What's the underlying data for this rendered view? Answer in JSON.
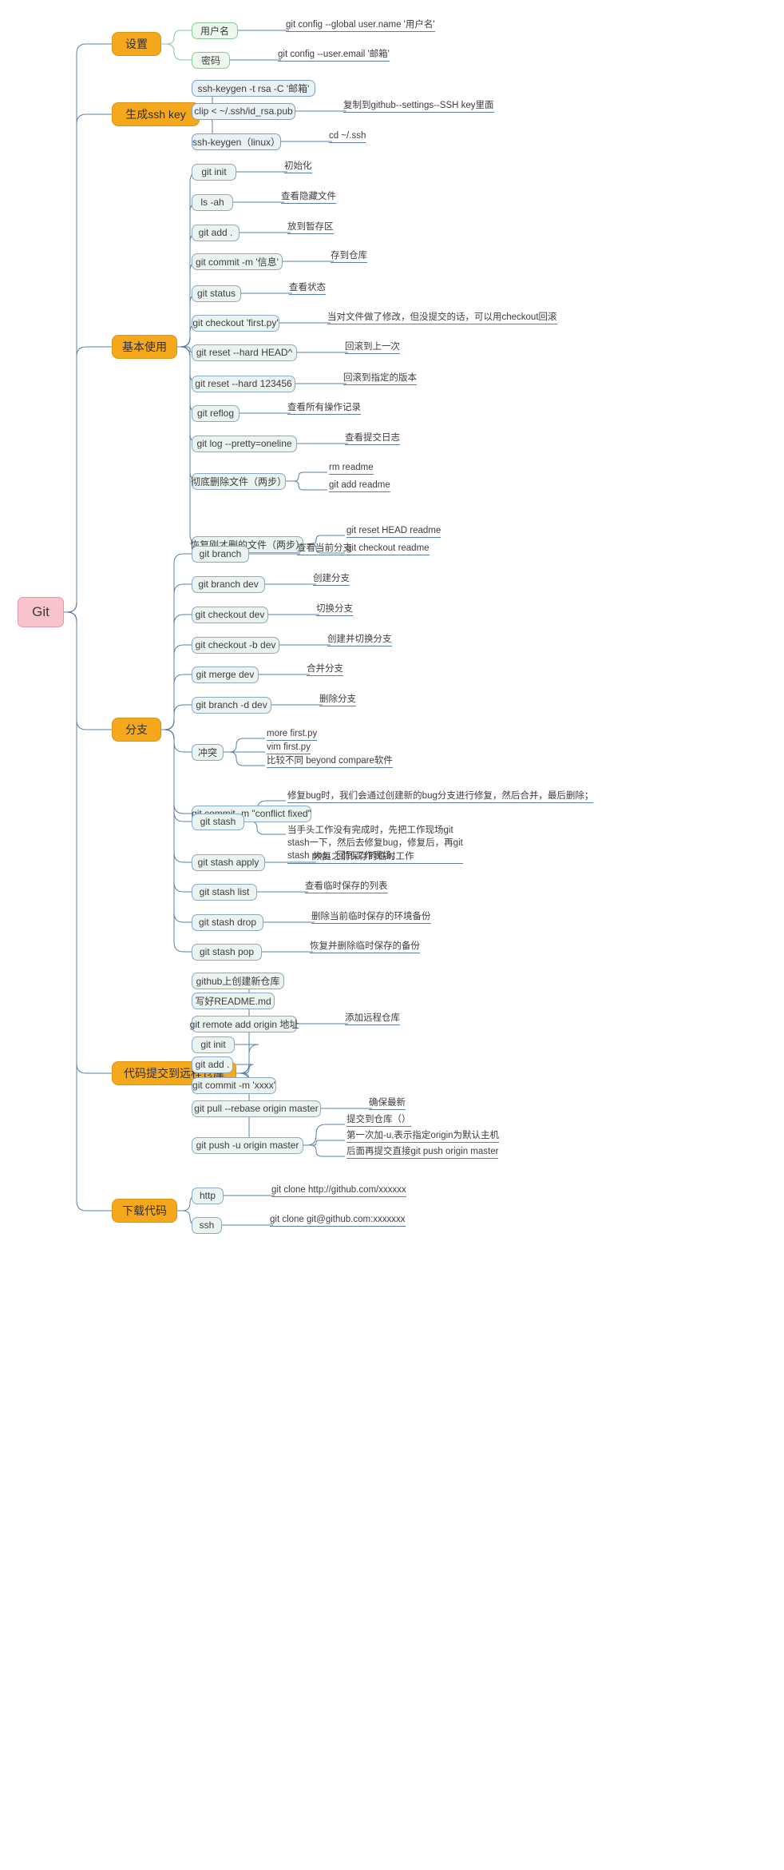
{
  "title": "Git",
  "colors": {
    "root_fill": "#f8c3cd",
    "level1_fill": "#f5a81c",
    "level2_fill": "#eaf3f0",
    "link_blue": "#5b7fa6",
    "link_green": "#8cc79a"
  },
  "root": {
    "label": "Git"
  },
  "branches": [
    {
      "id": "settings",
      "label": "设置",
      "children": [
        {
          "label": "用户名",
          "style": "green",
          "notes": [
            "git config --global user.name '用户名'"
          ]
        },
        {
          "label": "密码",
          "style": "green",
          "notes": [
            "git config --user.email '邮箱'"
          ]
        }
      ]
    },
    {
      "id": "sshkey",
      "label": "生成ssh key",
      "children": [
        {
          "label": "ssh-keygen -t rsa -C '邮箱'",
          "style": "blue",
          "notes": []
        },
        {
          "label": "clip < ~/.ssh/id_rsa.pub",
          "style": "blue",
          "notes": [
            "复制到github--settings--SSH key里面"
          ]
        },
        {
          "label": "ssh-keygen（linux）",
          "style": "blue",
          "notes": [
            "cd ~/.ssh"
          ]
        }
      ]
    },
    {
      "id": "basic",
      "label": "基本使用",
      "children": [
        {
          "label": "git init",
          "notes": [
            "初始化"
          ]
        },
        {
          "label": "ls -ah",
          "notes": [
            "查看隐藏文件"
          ]
        },
        {
          "label": "git add .",
          "notes": [
            "放到暂存区"
          ]
        },
        {
          "label": "git commit -m '信息'",
          "notes": [
            "存到仓库"
          ]
        },
        {
          "label": "git status",
          "notes": [
            "查看状态"
          ]
        },
        {
          "label": "git checkout 'first.py'",
          "notes": [
            "当对文件做了修改，但没提交的话，可以用checkout回滚"
          ]
        },
        {
          "label": "git reset --hard HEAD^",
          "notes": [
            "回滚到上一次"
          ]
        },
        {
          "label": "git reset --hard 123456",
          "notes": [
            "回滚到指定的版本"
          ]
        },
        {
          "label": "git reflog",
          "notes": [
            "查看所有操作记录"
          ]
        },
        {
          "label": "git log --pretty=oneline",
          "notes": [
            "查看提交日志"
          ]
        },
        {
          "label": "彻底删除文件（两步）",
          "notes": [
            "rm readme",
            "git add readme"
          ]
        },
        {
          "label": "恢复刚才删的文件（两步）",
          "notes": [
            "git reset HEAD readme",
            "git checkout readme"
          ]
        }
      ]
    },
    {
      "id": "branch",
      "label": "分支",
      "children": [
        {
          "label": "git branch",
          "notes": [
            "查看当前分支"
          ]
        },
        {
          "label": "git branch dev",
          "notes": [
            "创建分支"
          ]
        },
        {
          "label": "git checkout dev",
          "notes": [
            "切换分支"
          ]
        },
        {
          "label": "git checkout -b dev",
          "notes": [
            "创建并切换分支"
          ]
        },
        {
          "label": "git merge dev",
          "notes": [
            "合并分支"
          ]
        },
        {
          "label": "git  branch -d dev",
          "notes": [
            "删除分支"
          ]
        },
        {
          "label": "冲突",
          "notes": [
            "more first.py",
            "vim first.py",
            "比较不同 beyond compare软件"
          ]
        },
        {
          "label": "git commit -m \"conflict fixed\"",
          "notes": []
        },
        {
          "label": "git stash",
          "notes": [
            "修复bug时，我们会通过创建新的bug分支进行修复，然后合并，最后删除；",
            "当手头工作没有完成时，先把工作现场git\nstash一下，然后去修复bug，修复后，再git\nstash pop，回到工作现场。"
          ]
        },
        {
          "label": "git stash apply",
          "notes": [
            "恢复之前保存的临时工作"
          ]
        },
        {
          "label": "git stash list",
          "notes": [
            "查看临时保存的列表"
          ]
        },
        {
          "label": "git stash drop",
          "notes": [
            "删除当前临时保存的环境备份"
          ]
        },
        {
          "label": "git stash pop",
          "notes": [
            "恢复并删除临时保存的备份"
          ]
        }
      ]
    },
    {
      "id": "remote",
      "label": "代码提交到远程仓库",
      "children": [
        {
          "label": "github上创建新仓库",
          "notes": []
        },
        {
          "label": "写好README.md",
          "notes": []
        },
        {
          "label": "git remote add origin 地址",
          "notes": [
            "添加远程仓库"
          ]
        },
        {
          "label": "git init",
          "notes": []
        },
        {
          "label": "git add .",
          "notes": []
        },
        {
          "label": "git commit -m 'xxxx'",
          "notes": []
        },
        {
          "label": "git pull --rebase origin master",
          "notes": [
            "确保最新"
          ]
        },
        {
          "label": "git push -u origin master",
          "notes": [
            "提交到仓库（）",
            "第一次加-u,表示指定origin为默认主机",
            "后面再提交直接git push origin master"
          ]
        }
      ]
    },
    {
      "id": "download",
      "label": "下载代码",
      "children": [
        {
          "label": "http",
          "notes": [
            "git clone http://github.com/xxxxxx"
          ]
        },
        {
          "label": "ssh",
          "notes": [
            "git clone git@github.com:xxxxxxx"
          ]
        }
      ]
    }
  ]
}
